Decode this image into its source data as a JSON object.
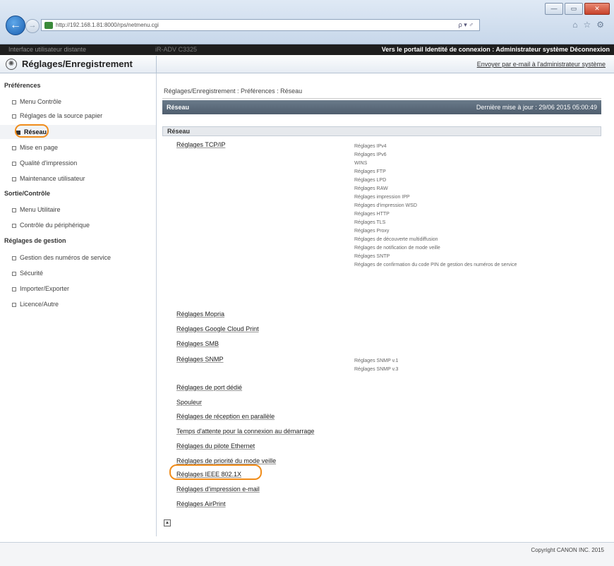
{
  "browser": {
    "url": "http://192.168.1.81:8000/rps/netmenu.cgi",
    "search_glyphs": "ρ ▾ ♂",
    "window_buttons": [
      "—",
      "▭",
      "✕"
    ]
  },
  "topbar": {
    "left_text": "Interface utilisateur distante",
    "mid_text": "iR-ADV C3325",
    "portal": "Vers le portail",
    "login_label": "Identité de connexion :",
    "user": "Administrateur système",
    "logout": "Déconnexion"
  },
  "header": {
    "title": "Réglages/Enregistrement",
    "email_link": "Envoyer par e-mail à l'administrateur système"
  },
  "sidebar": {
    "sections": [
      {
        "label": "Préférences",
        "items": [
          "Menu Contrôle",
          "Réglages de la source papier",
          "Réseau",
          "Mise en page",
          "Qualité d'impression",
          "Maintenance utilisateur"
        ]
      },
      {
        "label": "Sortie/Contrôle",
        "items": [
          "Menu Utilitaire",
          "Contrôle du périphérique"
        ]
      },
      {
        "label": "Réglages de gestion",
        "items": [
          "Gestion des numéros de service",
          "Sécurité",
          "Importer/Exporter",
          "Licence/Autre"
        ]
      }
    ]
  },
  "main": {
    "breadcrumb": "Réglages/Enregistrement : Préférences : Réseau",
    "section_title": "Réseau",
    "last_update": "Dernière mise à jour : 29/06 2015 05:00:49",
    "sub_section": "Réseau",
    "links": [
      "Réglages TCP/IP",
      "Réglages Mopria",
      "Réglages Google Cloud Print",
      "Réglages SMB",
      "Réglages SNMP",
      "Réglages de port dédié",
      "Spouleur",
      "Réglages de réception en parallèle",
      "Temps d'attente pour la connexion au démarrage",
      "Réglages du pilote Ethernet",
      "Réglages de priorité du mode veille",
      "Réglages IEEE 802.1X",
      "Réglages d'impression e-mail",
      "Réglages AirPrint"
    ],
    "tcpip_sublinks": [
      "Réglages IPv4",
      "Réglages IPv6",
      "WINS",
      "Réglages FTP",
      "Réglages LPD",
      "Réglages RAW",
      "Réglages impression IPP",
      "Réglages d'impression WSD",
      "Réglages HTTP",
      "Réglages TLS",
      "Réglages Proxy",
      "Réglages de découverte multidiffusion",
      "Réglages de notification de mode veille",
      "Réglages SNTP",
      "Réglages de confirmation du code PIN de gestion des numéros de service"
    ],
    "snmp_sublinks": [
      "Réglages SNMP v.1",
      "Réglages SNMP v.3"
    ],
    "top_button": "▲"
  },
  "footer": {
    "copyright": "Copyright CANON INC. 2015"
  },
  "colors": {
    "highlight": "#f08c1a",
    "header_bg": "#5a6a7a"
  }
}
